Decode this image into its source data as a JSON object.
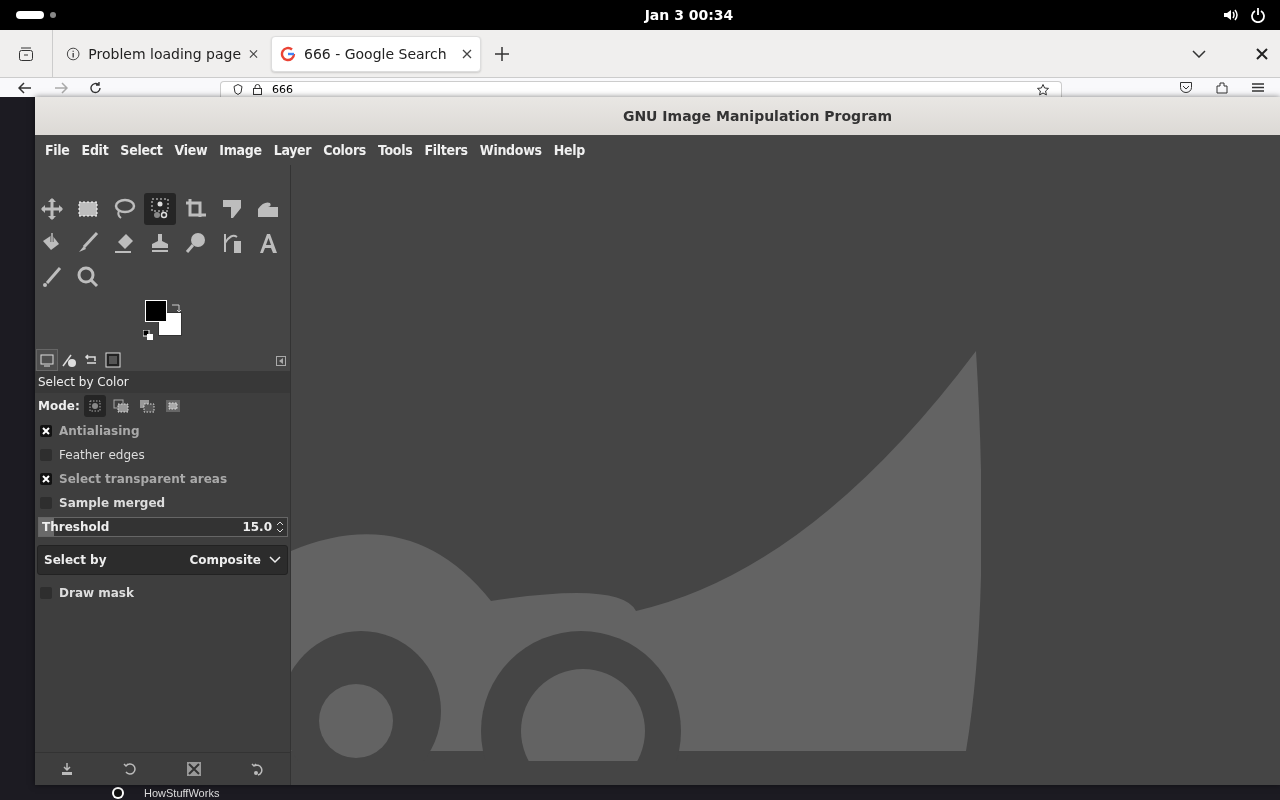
{
  "system_bar": {
    "clock": "Jan 3  00:34"
  },
  "browser": {
    "tabs": [
      {
        "label": "Problem loading page",
        "selected": false
      },
      {
        "label": "666 - Google Search",
        "selected": true
      }
    ],
    "address": "666",
    "page_text": "HowStuffWorks"
  },
  "gimp": {
    "window": {
      "title": "GNU Image Manipulation Program"
    },
    "menu": [
      "File",
      "Edit",
      "Select",
      "View",
      "Image",
      "Layer",
      "Colors",
      "Tools",
      "Filters",
      "Windows",
      "Help"
    ],
    "tools": [
      {
        "kind": "move",
        "selected": false
      },
      {
        "kind": "rect",
        "selected": false
      },
      {
        "kind": "lasso",
        "selected": false
      },
      {
        "kind": "bycolor",
        "selected": true
      },
      {
        "kind": "crop",
        "selected": false
      },
      {
        "kind": "transform",
        "selected": false
      },
      {
        "kind": "warp",
        "selected": false
      },
      {
        "kind": "bucket",
        "selected": false
      },
      {
        "kind": "brush",
        "selected": false
      },
      {
        "kind": "eraser",
        "selected": false
      },
      {
        "kind": "clone",
        "selected": false
      },
      {
        "kind": "smudge",
        "selected": false
      },
      {
        "kind": "path",
        "selected": false
      },
      {
        "kind": "text",
        "selected": false
      },
      {
        "kind": "picker",
        "selected": false
      },
      {
        "kind": "zoom",
        "selected": false
      }
    ],
    "dock_tabs": [
      {
        "selected": true
      },
      {
        "selected": false
      },
      {
        "selected": false
      },
      {
        "selected": false
      }
    ],
    "tool_options": {
      "title": "Select by Color",
      "mode_label": "Mode:",
      "modes": [
        {
          "selected": true
        },
        {
          "selected": false
        },
        {
          "selected": false
        },
        {
          "selected": false
        }
      ],
      "toggles": [
        {
          "label": "Antialiasing",
          "checked": true
        },
        {
          "label": "Feather edges",
          "checked": false
        },
        {
          "label": "Select transparent areas",
          "checked": true
        },
        {
          "label": "Sample merged",
          "checked": false
        }
      ],
      "threshold": {
        "label": "Threshold",
        "value": "15.0",
        "level": 0.06
      },
      "select_by": {
        "label": "Select by",
        "value": "Composite"
      },
      "draw_mask": {
        "label": "Draw mask",
        "checked": false
      }
    }
  }
}
